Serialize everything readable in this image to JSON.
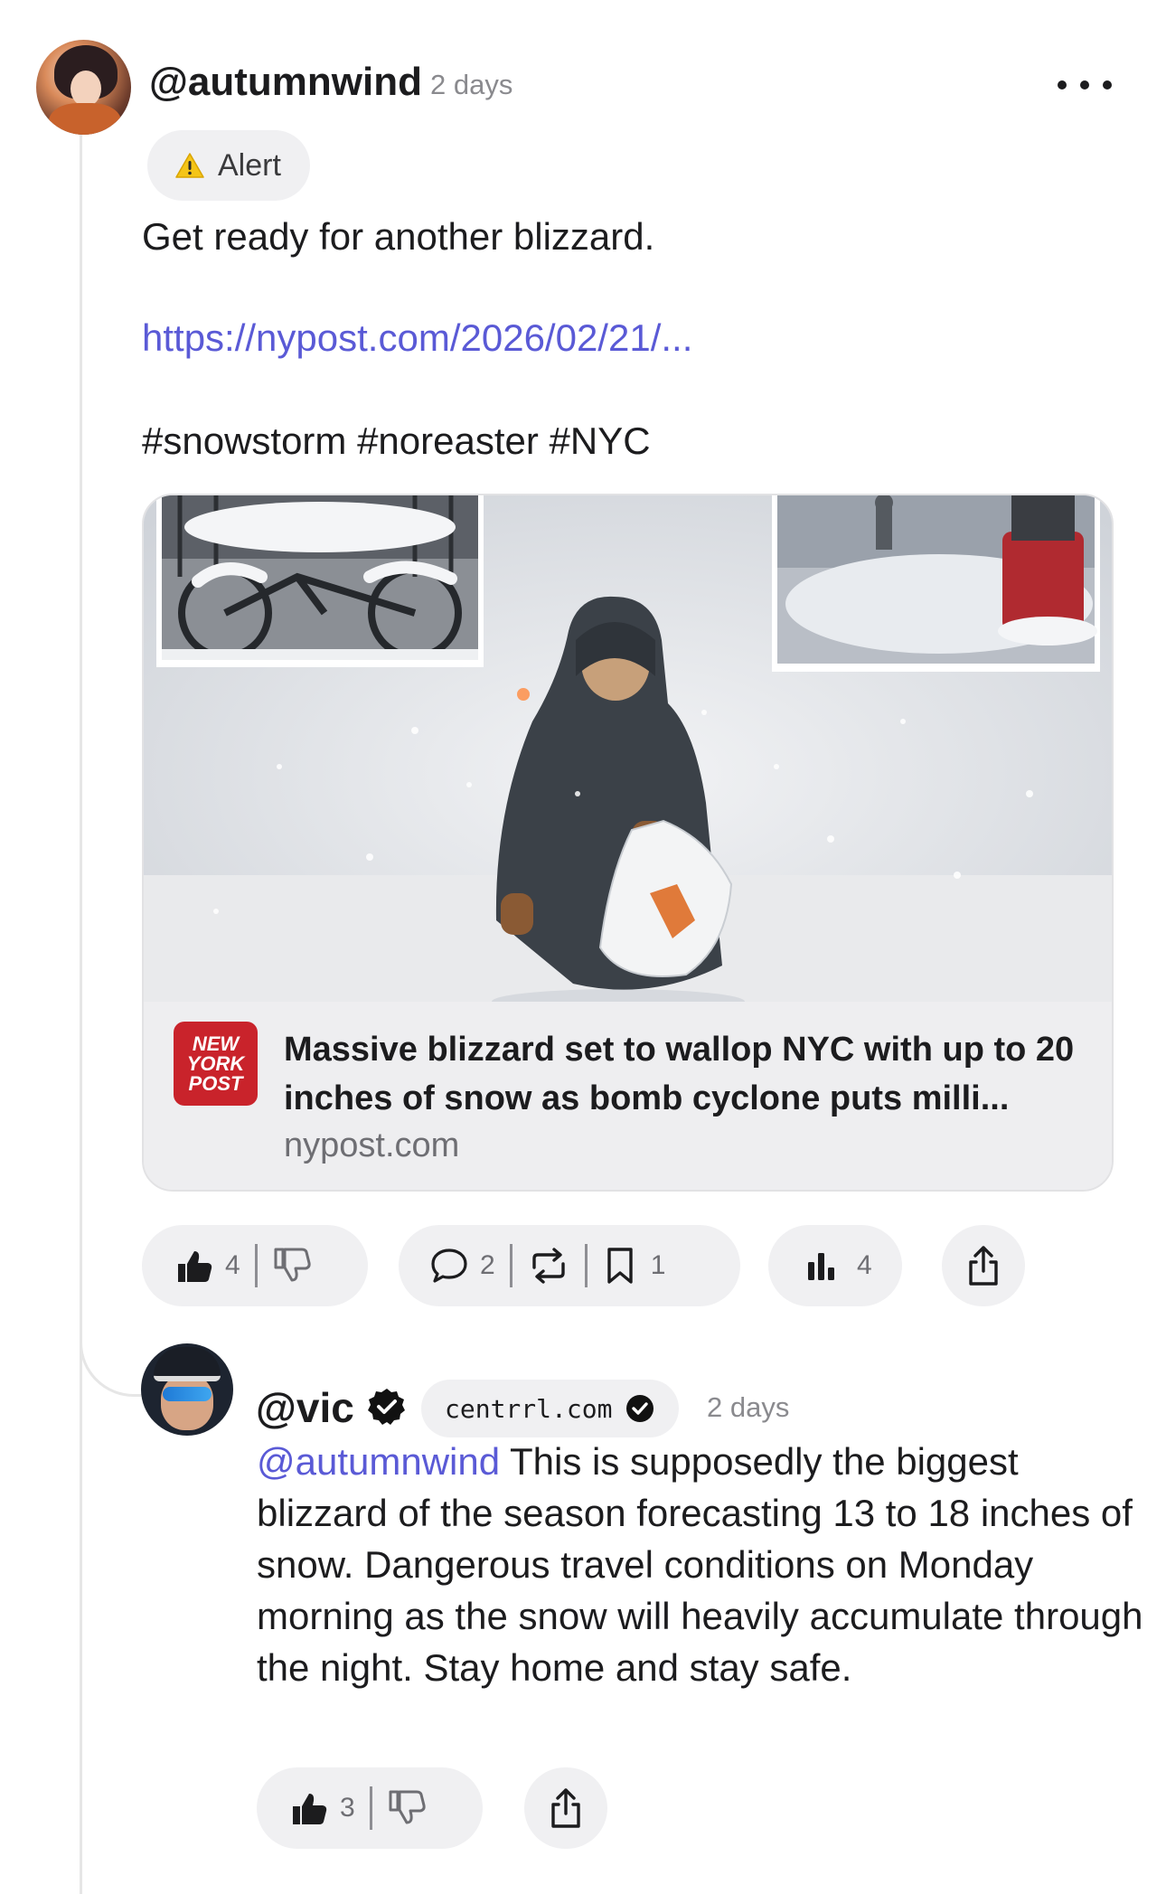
{
  "post": {
    "username": "@autumnwind",
    "time": "2 days",
    "tag": "Alert",
    "text": "Get ready for another blizzard.",
    "link": "https://nypost.com/2026/02/21/...",
    "hashtags": "#snowstorm #noreaster #NYC",
    "card": {
      "logo_lines": [
        "NEW",
        "YORK",
        "POST"
      ],
      "title": "Massive blizzard set to wallop NYC with up to 20 inches of snow as bomb cyclone puts milli...",
      "domain": "nypost.com"
    },
    "actions": {
      "likes": "4",
      "comments": "2",
      "bookmarks": "1",
      "views": "4"
    }
  },
  "reply": {
    "username": "@vic",
    "domain": "centrrl.com",
    "time": "2 days",
    "mention": "@autumnwind",
    "text": " This is supposedly the biggest blizzard of the season forecasting 13 to 18 inches of snow. Dangerous travel conditions on Monday morning as the snow will heavily accumulate through the night. Stay home and stay safe.",
    "actions": {
      "likes": "3"
    }
  },
  "colors": {
    "link": "#5a5ad6",
    "pill_bg": "#f0f0f2",
    "nypost_red": "#c9232b"
  }
}
